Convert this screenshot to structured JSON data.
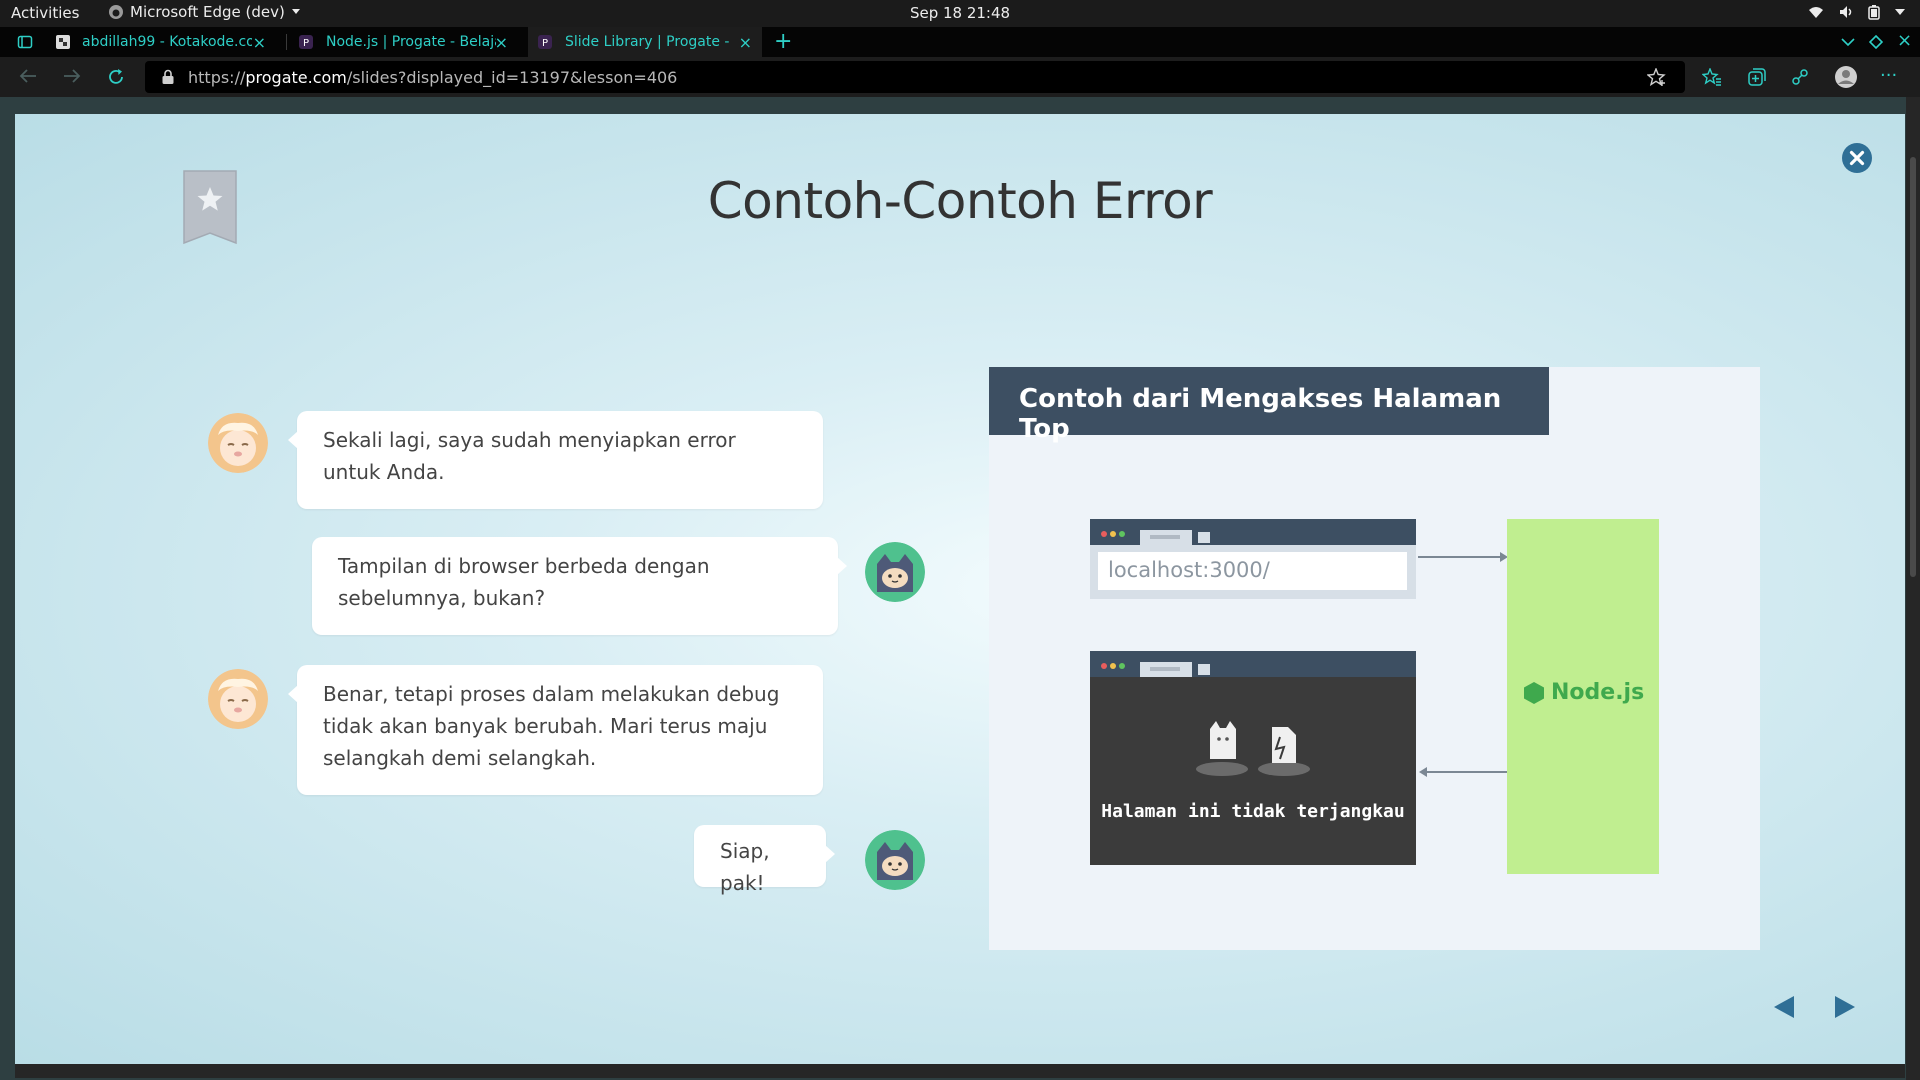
{
  "system_bar": {
    "activities": "Activities",
    "app_name": "Microsoft Edge (dev)",
    "datetime": "Sep 18  21:48"
  },
  "browser": {
    "tabs": [
      {
        "title": "abdillah99 - Kotakode.com",
        "active": false
      },
      {
        "title": "Node.js | Progate - Belajar",
        "active": false
      },
      {
        "title": "Slide Library | Progate - Belajar",
        "active": true
      }
    ],
    "url_prefix": "https://",
    "url_domain": "progate.com",
    "url_path": "/slides?displayed_id=13197&lesson=406"
  },
  "slide": {
    "title": "Contoh-Contoh Error",
    "dialog": [
      {
        "speaker": "sheep",
        "side": "left",
        "text": "Sekali lagi, saya sudah menyiapkan error untuk Anda."
      },
      {
        "speaker": "ninja",
        "side": "right",
        "text": "Tampilan di browser berbeda dengan sebelumnya, bukan?"
      },
      {
        "speaker": "sheep",
        "side": "left",
        "text": "Benar, tetapi proses dalam melakukan debug tidak akan banyak berubah. Mari terus maju selangkah demi selangkah."
      },
      {
        "speaker": "ninja",
        "side": "right",
        "text": "Siap, pak!"
      }
    ],
    "figure": {
      "heading": "Contoh dari Mengakses Halaman Top",
      "address_text": "localhost:3000/",
      "error_text": "Halaman ini tidak terjangkau",
      "server_label": "Node.js"
    }
  },
  "colors": {
    "tab_text": "#2ecfc6",
    "figure_header": "#3d4f62",
    "node_box": "#c0ee90",
    "node_text": "#3fa94d",
    "nav_arrow": "#2f6f96"
  }
}
